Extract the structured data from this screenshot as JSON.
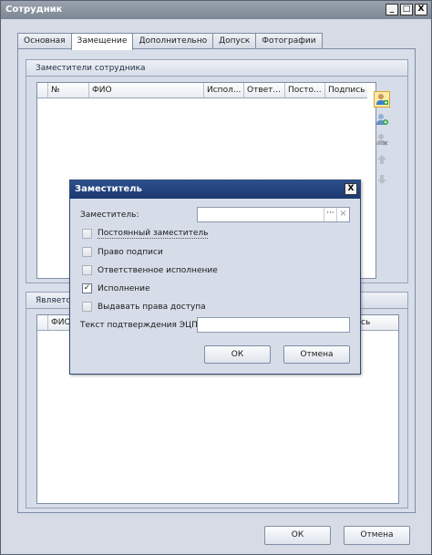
{
  "window": {
    "title": "Сотрудник",
    "buttons": [
      "_",
      "□",
      "X"
    ]
  },
  "tabs": [
    "Основная",
    "Замещение",
    "Дополнительно",
    "Допуск",
    "Фотографии"
  ],
  "active_tab": "Замещение",
  "deputies_group": {
    "title": "Заместители сотрудника",
    "columns": [
      "№",
      "ФИО",
      "Испол...",
      "Ответ...",
      "Посто...",
      "Подпись"
    ]
  },
  "toolbar_icons": [
    "add-user-icon",
    "add-icon",
    "remove-user-icon",
    "arrow-up-icon",
    "arrow-down-icon"
  ],
  "is_deputy_group": {
    "title": "Является",
    "columns": [
      "ФИО",
      "сь"
    ]
  },
  "footer": {
    "ok": "ОК",
    "cancel": "Отмена"
  },
  "dialog": {
    "title": "Заместитель",
    "close": "X",
    "deputy_label": "Заместитель:",
    "deputy_value": "",
    "ellipsis": "···",
    "clear": "×",
    "checkboxes": [
      {
        "label": "Постоянный заместитель",
        "checked": false
      },
      {
        "label": "Право подписи",
        "checked": false
      },
      {
        "label": "Ответственное исполнение",
        "checked": false
      },
      {
        "label": "Исполнение",
        "checked": true
      },
      {
        "label": "Выдавать права доступа",
        "checked": false
      }
    ],
    "ecp_label": "Текст подтверждения ЭЦП:",
    "ecp_value": "",
    "ok": "ОК",
    "cancel": "Отмена"
  }
}
